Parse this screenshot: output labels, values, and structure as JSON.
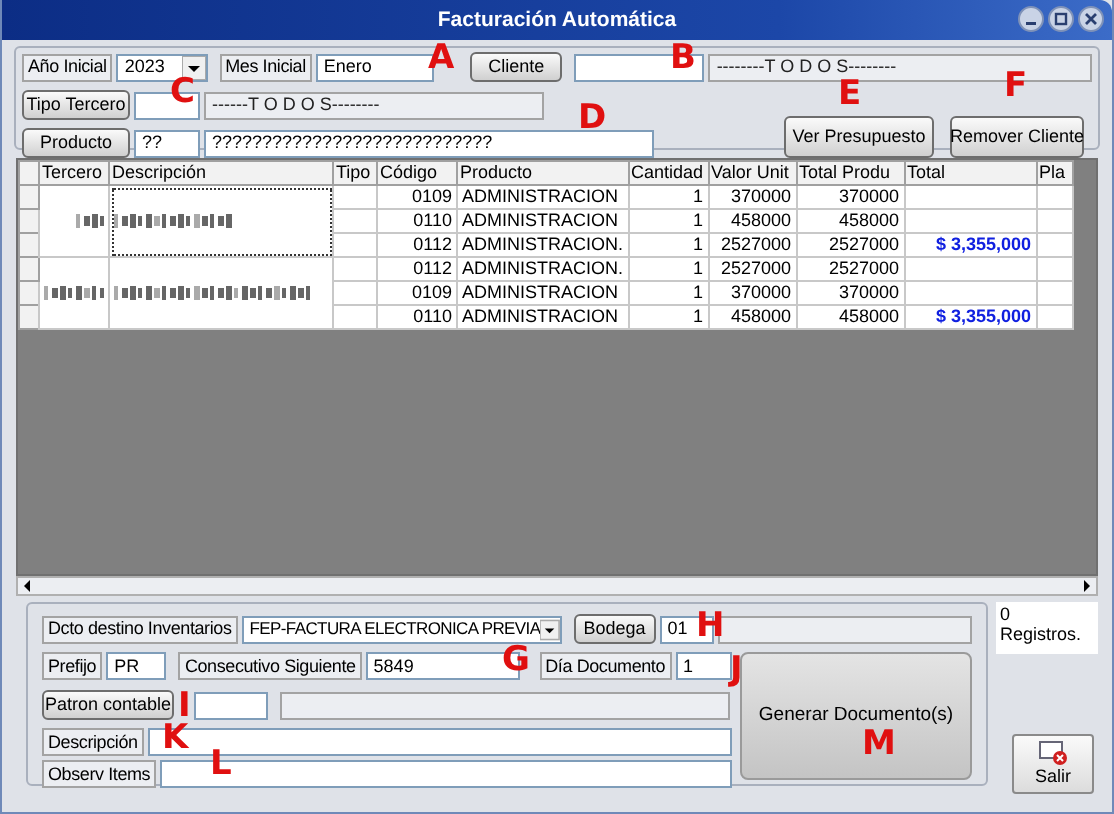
{
  "window": {
    "title": "Facturación Automática"
  },
  "filters": {
    "year_label": "Año Inicial",
    "year": "2023",
    "month_label": "Mes Inicial",
    "month": "Enero",
    "client_button": "Cliente",
    "client_name": "--------T O D O S--------",
    "third_type_button": "Tipo Tercero",
    "third_type_name": "------T O D O S--------",
    "product_button": "Producto",
    "product_code": "??",
    "product_name": "????????????????????????????",
    "budget_button": "Ver Presupuesto",
    "remove_client_button": "Remover Cliente"
  },
  "grid": {
    "columns": [
      "Tercero",
      "Descripción",
      "Tipo",
      "Código",
      "Producto",
      "Cantidad",
      "Valor Unit",
      "Total Produ",
      "Total",
      "Pla"
    ],
    "groups": [
      {
        "selected": true,
        "rows": [
          {
            "code": "0109",
            "product": "ADMINISTRACION",
            "quantity": "1",
            "unit_value": "370000",
            "product_total": "370000"
          },
          {
            "code": "0110",
            "product": "ADMINISTRACION",
            "quantity": "1",
            "unit_value": "458000",
            "product_total": "458000"
          },
          {
            "code": "0112",
            "product": "ADMINISTRACION.",
            "quantity": "1",
            "unit_value": "2527000",
            "product_total": "2527000",
            "total": "$ 3,355,000"
          }
        ]
      },
      {
        "selected": false,
        "rows": [
          {
            "code": "0112",
            "product": "ADMINISTRACION.",
            "quantity": "1",
            "unit_value": "2527000",
            "product_total": "2527000"
          },
          {
            "code": "0109",
            "product": "ADMINISTRACION",
            "quantity": "1",
            "unit_value": "370000",
            "product_total": "370000"
          },
          {
            "code": "0110",
            "product": "ADMINISTRACION",
            "quantity": "1",
            "unit_value": "458000",
            "product_total": "458000",
            "total": "$ 3,355,000"
          }
        ]
      }
    ]
  },
  "document": {
    "target_label": "Dcto destino Inventarios",
    "target": "FEP-FACTURA ELECTRONICA PREVIA",
    "warehouse_button": "Bodega",
    "warehouse": "01",
    "prefix_label": "Prefijo",
    "prefix": "PR",
    "next_label": "Consecutivo Siguiente",
    "next": "5849",
    "day_label": "Día Documento",
    "day": "1",
    "pattern_button": "Patron contable",
    "description_label": "Descripción",
    "items_label": "Observ Items",
    "generate_button": "Generar Documento(s)"
  },
  "records": "0 Registros.",
  "exit_button": "Salir",
  "annotations": [
    {
      "label": "A"
    },
    {
      "label": "B"
    },
    {
      "label": "C"
    },
    {
      "label": "D"
    },
    {
      "label": "E"
    },
    {
      "label": "F"
    },
    {
      "label": "G"
    },
    {
      "label": "H"
    },
    {
      "label": "I"
    },
    {
      "label": "J"
    },
    {
      "label": "K"
    },
    {
      "label": "L"
    },
    {
      "label": "M"
    }
  ]
}
